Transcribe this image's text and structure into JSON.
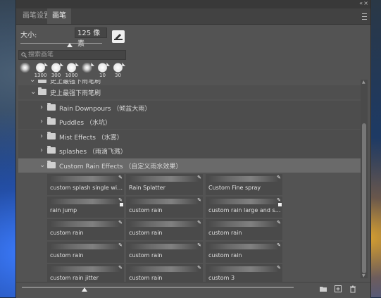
{
  "panel": {
    "tabs": [
      {
        "label": "画笔设置",
        "active": false
      },
      {
        "label": "画笔",
        "active": true
      }
    ],
    "collapse_glyph": "«",
    "close_glyph": "×"
  },
  "brush_size": {
    "label": "大小:",
    "value": "125 像素",
    "slider_value_fraction": 0.6
  },
  "search": {
    "placeholder": "搜索画笔",
    "value": ""
  },
  "recent_brushes": [
    {
      "label": "",
      "style": "soft"
    },
    {
      "label": "1300",
      "style": "hard"
    },
    {
      "label": "300",
      "style": "hard"
    },
    {
      "label": "1000",
      "style": "hard"
    },
    {
      "label": "",
      "style": "soft"
    },
    {
      "label": "10",
      "style": "hard"
    },
    {
      "label": "30",
      "style": "hard"
    }
  ],
  "tree": {
    "partial_top": "史上最强下雨笔刷",
    "root": "史上最强下雨笔刷",
    "groups": [
      {
        "label": "Rain Downpours （倾盆大雨）",
        "expanded": false
      },
      {
        "label": "Puddles （水坑）",
        "expanded": false
      },
      {
        "label": "Mist Effects （水雾）",
        "expanded": false
      },
      {
        "label": "splashes （雨滴飞溅）",
        "expanded": false
      },
      {
        "label": "Custom Rain Effects （自定义雨水效果）",
        "expanded": true
      }
    ]
  },
  "brushes": [
    {
      "name": "custom splash single with t...",
      "badge": "pen"
    },
    {
      "name": "Rain Splatter",
      "badge": "pen"
    },
    {
      "name": "Custom Fine spray",
      "badge": "pen"
    },
    {
      "name": "rain jump",
      "badge": "pen-square"
    },
    {
      "name": "custom rain",
      "badge": "pen"
    },
    {
      "name": "custom rain large and small",
      "badge": "pen-square"
    },
    {
      "name": "custom rain",
      "badge": "pen"
    },
    {
      "name": "custom rain",
      "badge": "pen"
    },
    {
      "name": "custom rain",
      "badge": "pen"
    },
    {
      "name": "custom rain",
      "badge": "pen"
    },
    {
      "name": "custom rain",
      "badge": "pen"
    },
    {
      "name": "custom rain",
      "badge": "pen"
    },
    {
      "name": "custom rain jitter",
      "badge": "pen"
    },
    {
      "name": "custom rain",
      "badge": "pen"
    },
    {
      "name": "custom 3",
      "badge": "pen"
    }
  ],
  "bottom_bar": {
    "preview_size_fraction": 0.23,
    "icons": [
      "new-group-icon",
      "new-brush-icon",
      "trash-icon"
    ]
  },
  "colors": {
    "panel_bg": "#535353",
    "tab_bar": "#424242",
    "selected_row": "#6a6a6a",
    "text": "#d6d6d6"
  }
}
